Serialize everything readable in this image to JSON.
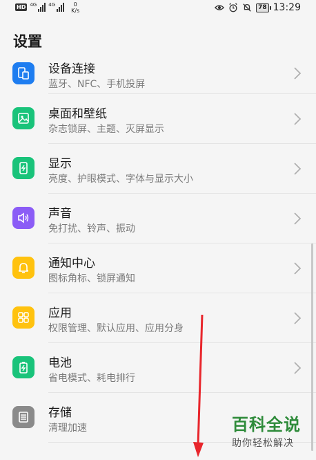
{
  "status_bar": {
    "hd": "HD",
    "signal1": "4G",
    "signal2": "4G",
    "net_speed_value": "0",
    "net_speed_unit": "K/s",
    "battery": "78",
    "time": "13:29",
    "icons": [
      "eye-comfort-icon",
      "alarm-icon",
      "silent-icon"
    ]
  },
  "page": {
    "title": "设置"
  },
  "settings": [
    {
      "name": "device-connection",
      "title": "设备连接",
      "subtitle": "蓝牙、NFC、手机投屏",
      "icon": "device-connect-icon",
      "color": "#1e7df0"
    },
    {
      "name": "desktop-wallpaper",
      "title": "桌面和壁纸",
      "subtitle": "杂志锁屏、主题、灭屏显示",
      "icon": "wallpaper-icon",
      "color": "#19c37a"
    },
    {
      "name": "display",
      "title": "显示",
      "subtitle": "亮度、护眼模式、字体与显示大小",
      "icon": "display-icon",
      "color": "#19c37a"
    },
    {
      "name": "sound",
      "title": "声音",
      "subtitle": "免打扰、铃声、振动",
      "icon": "sound-icon",
      "color": "#8b5cf6"
    },
    {
      "name": "notification-center",
      "title": "通知中心",
      "subtitle": "图标角标、锁屏通知",
      "icon": "bell-icon",
      "color": "#ffc20e"
    },
    {
      "name": "apps",
      "title": "应用",
      "subtitle": "权限管理、默认应用、应用分身",
      "icon": "apps-grid-icon",
      "color": "#ffc20e"
    },
    {
      "name": "battery",
      "title": "电池",
      "subtitle": "省电模式、耗电排行",
      "icon": "battery-icon",
      "color": "#19c37a"
    },
    {
      "name": "storage",
      "title": "存储",
      "subtitle": "清理加速",
      "icon": "storage-icon",
      "color": "#8a8a8a"
    }
  ],
  "watermark": {
    "title": "百科全说",
    "subtitle": "助你轻松解决"
  },
  "colors": {
    "background": "#f5f5f5",
    "annotation_arrow": "#e8262c",
    "watermark_green": "#2e8b3a"
  }
}
